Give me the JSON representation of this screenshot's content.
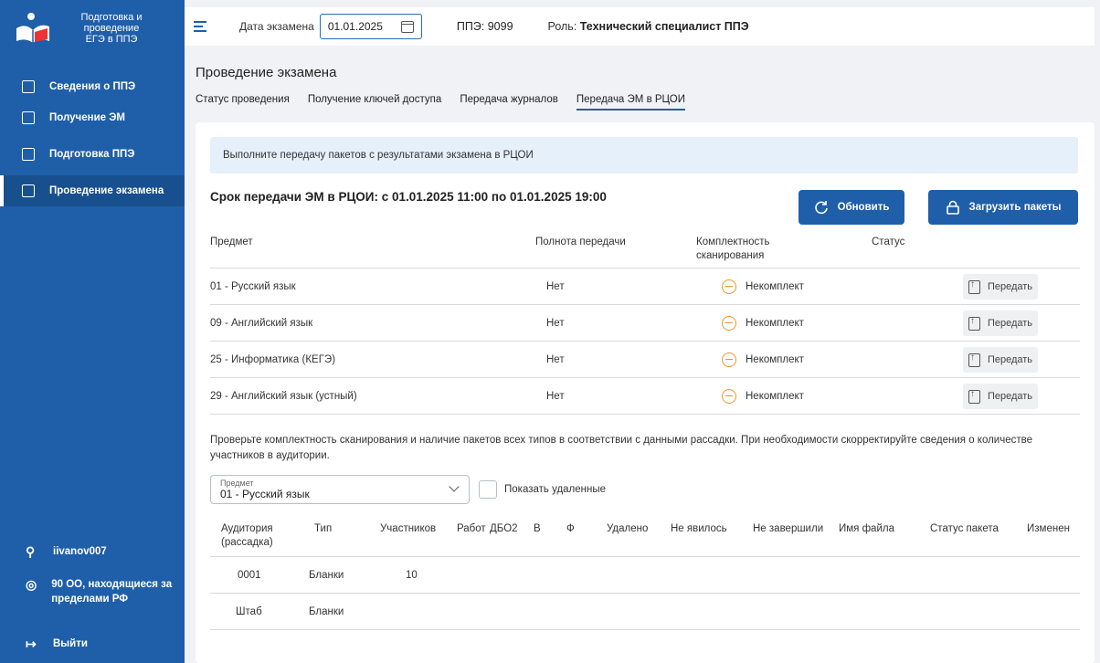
{
  "sidebar": {
    "logo_text": "Подготовка и проведение ЕГЭ в ППЭ",
    "items": [
      {
        "label": "Сведения о ППЭ",
        "icon": "save-icon"
      },
      {
        "label": "Получение ЭМ",
        "icon": "document-edit-icon"
      },
      {
        "label": "Подготовка ППЭ",
        "icon": "door-icon"
      },
      {
        "label": "Проведение экзамена",
        "icon": "document-check-icon"
      }
    ],
    "user": "iivanov007",
    "location": "90 ОО, находящиеся за пределами РФ",
    "logout": "Выйти"
  },
  "topbar": {
    "date_label": "Дата экзамена",
    "date_value": "01.01.2025",
    "ppe": "ППЭ: 9099",
    "role_label": "Роль:",
    "role_value": "Технический специалист ППЭ"
  },
  "main": {
    "title": "Проведение экзамена",
    "tabs": [
      "Статус проведения",
      "Получение ключей доступа",
      "Передача журналов",
      "Передача ЭМ в РЦОИ"
    ],
    "active_tab": 3
  },
  "info_text": "Выполните передачу пакетов с результатами экзамена в РЦОИ",
  "deadline": "Срок передачи ЭМ в РЦОИ: с 01.01.2025 11:00 по 01.01.2025 19:00",
  "buttons": {
    "refresh": "Обновить",
    "upload": "Загрузить пакеты"
  },
  "table1": {
    "headers": {
      "subject": "Предмет",
      "completeness": "Полнота передачи",
      "scan_line1": "Комплектность",
      "scan_line2": "сканирования",
      "status": "Статус"
    },
    "rows": [
      {
        "subject": "01 - Русский язык",
        "completeness": "Нет",
        "scan": "Некомплект",
        "action": "Передать"
      },
      {
        "subject": "09 - Английский язык",
        "completeness": "Нет",
        "scan": "Некомплект",
        "action": "Передать"
      },
      {
        "subject": "25 - Информатика (КЕГЭ)",
        "completeness": "Нет",
        "scan": "Некомплект",
        "action": "Передать"
      },
      {
        "subject": "29 - Английский язык (устный)",
        "completeness": "Нет",
        "scan": "Некомплект",
        "action": "Передать"
      }
    ]
  },
  "note": "Проверьте комплектность сканирования и наличие пакетов всех типов в соответствии с данными рассадки. При необходимости скорректируйте сведения о количестве участников в аудитории.",
  "filter": {
    "label": "Предмет",
    "value": "01 - Русский язык",
    "show_deleted": "Показать удаленные"
  },
  "table2": {
    "headers": {
      "aud1": "Аудитория",
      "aud2": "(рассадка)",
      "type": "Тип",
      "participants": "Участников",
      "works": "Работ",
      "dbo2": "ДБО2",
      "v": "В",
      "f": "Ф",
      "deleted": "Удалено",
      "absent": "Не явилось",
      "unfinished": "Не завершили",
      "filename": "Имя файла",
      "pkg_status": "Статус пакета",
      "changed": "Изменен"
    },
    "rows": [
      {
        "aud": "0001",
        "type": "Бланки",
        "participants": "10"
      },
      {
        "aud": "Штаб",
        "type": "Бланки",
        "participants": ""
      }
    ]
  },
  "colors": {
    "sidebar": "#1f5fa9",
    "accent": "#1f5fa9",
    "warning": "#f0952b",
    "info_bg": "#e5f0fb"
  }
}
